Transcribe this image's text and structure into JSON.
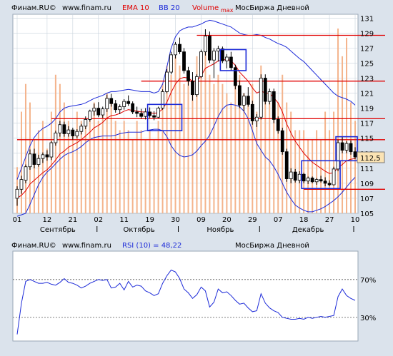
{
  "colors": {
    "background": "#dbe3ec",
    "plot_bg": "#ffffff",
    "grid": "#c8d2dc",
    "candle": "#000000",
    "ema": "#e00000",
    "bb": "#1c2ad8",
    "volume": "#f4b48c",
    "hline": "#e00000",
    "box": "#1c2ad8",
    "rsi": "#1c2ad8",
    "price_tag_bg": "#fbe3b3"
  },
  "main_header": {
    "brand": "Финам.RU©",
    "site": "www.finam.ru",
    "ema": "EMA 10",
    "bb": "BB 20",
    "volume": "Volume",
    "max": "max",
    "exchange": "МосБиржа Дневной"
  },
  "rsi_header": {
    "brand": "Финам.RU©",
    "site": "www.finam.ru",
    "rsi": "RSI (10) = 48,22",
    "exchange": "МосБиржа Дневной"
  },
  "last_price": "112,5",
  "chart_data": [
    {
      "type": "candlestick",
      "x_tick_labels": [
        "01",
        "12",
        "21",
        "02",
        "11",
        "19",
        "30",
        "09",
        "20",
        "29",
        "07",
        "18",
        "27",
        "10"
      ],
      "month_labels": [
        "Сентябрь",
        "Октябрь",
        "Ноябрь",
        "Декабрь"
      ],
      "y_ticks": [
        105,
        107,
        109,
        111,
        113,
        115,
        117,
        119,
        121,
        123,
        125,
        127,
        129,
        131
      ],
      "ylim": [
        105,
        131.5
      ],
      "grid": true,
      "candles": [
        [
          107.0,
          108.6,
          106.0,
          108.2
        ],
        [
          108.2,
          110.0,
          107.6,
          109.5
        ],
        [
          109.4,
          111.5,
          109.0,
          111.2
        ],
        [
          111.2,
          113.5,
          110.8,
          112.9
        ],
        [
          112.9,
          113.6,
          111.0,
          111.5
        ],
        [
          111.5,
          112.8,
          111.2,
          112.3
        ],
        [
          112.3,
          113.1,
          111.7,
          112.8
        ],
        [
          112.8,
          113.4,
          112.0,
          112.5
        ],
        [
          112.5,
          114.6,
          112.1,
          114.4
        ],
        [
          114.4,
          116.0,
          114.0,
          115.7
        ],
        [
          115.7,
          117.3,
          115.2,
          116.8
        ],
        [
          116.8,
          117.2,
          115.2,
          115.6
        ],
        [
          115.6,
          116.6,
          115.2,
          116.1
        ],
        [
          116.1,
          116.4,
          114.8,
          115.3
        ],
        [
          115.3,
          116.2,
          115.0,
          115.9
        ],
        [
          115.9,
          116.9,
          115.5,
          116.6
        ],
        [
          116.6,
          117.9,
          116.2,
          117.5
        ],
        [
          117.5,
          118.8,
          117.2,
          118.6
        ],
        [
          118.6,
          119.6,
          118.0,
          119.0
        ],
        [
          119.0,
          119.8,
          117.8,
          118.1
        ],
        [
          118.1,
          119.2,
          117.7,
          118.9
        ],
        [
          118.9,
          120.8,
          118.5,
          120.3
        ],
        [
          120.3,
          120.9,
          119.2,
          119.6
        ],
        [
          119.6,
          120.1,
          118.4,
          118.8
        ],
        [
          118.8,
          119.5,
          118.2,
          119.2
        ],
        [
          119.2,
          120.2,
          118.8,
          119.9
        ],
        [
          119.9,
          120.7,
          119.3,
          119.6
        ],
        [
          119.6,
          119.9,
          118.2,
          118.5
        ],
        [
          118.5,
          119.2,
          117.8,
          118.3
        ],
        [
          118.3,
          118.9,
          117.6,
          117.9
        ],
        [
          117.9,
          119.0,
          117.5,
          118.5
        ],
        [
          118.5,
          119.1,
          117.7,
          118.0
        ],
        [
          118.0,
          118.6,
          117.4,
          117.8
        ],
        [
          117.8,
          119.2,
          117.7,
          119.0
        ],
        [
          119.0,
          121.5,
          118.8,
          121.2
        ],
        [
          121.2,
          124.2,
          121.0,
          123.8
        ],
        [
          123.8,
          126.5,
          123.5,
          126.1
        ],
        [
          126.1,
          127.8,
          125.6,
          127.5
        ],
        [
          127.5,
          128.4,
          126.2,
          126.5
        ],
        [
          126.5,
          127.0,
          123.6,
          124.0
        ],
        [
          124.0,
          124.5,
          122.0,
          122.6
        ],
        [
          122.6,
          123.8,
          120.0,
          120.8
        ],
        [
          120.8,
          123.5,
          120.5,
          123.2
        ],
        [
          123.2,
          126.8,
          123.0,
          126.5
        ],
        [
          126.5,
          129.5,
          126.0,
          128.6
        ],
        [
          128.6,
          129.2,
          125.0,
          125.4
        ],
        [
          125.4,
          127.0,
          123.0,
          126.6
        ],
        [
          126.6,
          127.3,
          125.2,
          126.9
        ],
        [
          126.9,
          127.2,
          125.0,
          125.3
        ],
        [
          125.3,
          126.2,
          124.3,
          125.8
        ],
        [
          125.8,
          126.5,
          124.0,
          124.4
        ],
        [
          124.4,
          124.8,
          121.5,
          122.0
        ],
        [
          122.0,
          122.7,
          119.0,
          119.4
        ],
        [
          119.4,
          121.0,
          118.6,
          120.6
        ],
        [
          120.6,
          121.8,
          119.2,
          119.5
        ],
        [
          119.5,
          120.0,
          116.8,
          117.3
        ],
        [
          117.3,
          118.2,
          116.5,
          117.8
        ],
        [
          117.8,
          123.5,
          117.5,
          123.0
        ],
        [
          123.0,
          123.5,
          119.5,
          119.9
        ],
        [
          119.9,
          121.6,
          119.5,
          121.2
        ],
        [
          121.2,
          121.6,
          117.0,
          117.5
        ],
        [
          117.5,
          117.9,
          115.6,
          116.0
        ],
        [
          116.0,
          116.4,
          112.8,
          113.2
        ],
        [
          113.2,
          113.6,
          109.2,
          109.6
        ],
        [
          109.6,
          111.0,
          109.0,
          110.5
        ],
        [
          110.5,
          110.9,
          109.1,
          109.4
        ],
        [
          109.4,
          110.6,
          109.0,
          110.2
        ],
        [
          110.2,
          110.4,
          109.0,
          109.3
        ],
        [
          109.3,
          109.9,
          108.9,
          109.7
        ],
        [
          109.7,
          109.9,
          109.0,
          109.2
        ],
        [
          109.2,
          109.7,
          108.8,
          109.5
        ],
        [
          109.5,
          110.0,
          109.1,
          109.3
        ],
        [
          109.3,
          109.8,
          108.6,
          109.0
        ],
        [
          109.0,
          109.4,
          108.6,
          108.8
        ],
        [
          108.8,
          111.2,
          108.7,
          110.9
        ],
        [
          110.9,
          114.8,
          110.6,
          114.4
        ],
        [
          114.4,
          115.2,
          113.0,
          113.4
        ],
        [
          113.4,
          114.6,
          113.0,
          114.3
        ],
        [
          114.3,
          114.7,
          112.8,
          113.2
        ],
        [
          113.2,
          113.8,
          112.2,
          112.5
        ]
      ],
      "ema_10": [
        107.0,
        107.4,
        108.0,
        108.9,
        109.4,
        109.9,
        110.4,
        110.8,
        111.4,
        112.1,
        112.9,
        113.3,
        113.8,
        114.1,
        114.4,
        114.8,
        115.3,
        115.8,
        116.4,
        116.7,
        117.1,
        117.7,
        118.0,
        118.1,
        118.3,
        118.6,
        118.8,
        118.7,
        118.6,
        118.5,
        118.5,
        118.4,
        118.3,
        118.4,
        118.9,
        119.8,
        121.1,
        122.2,
        122.9,
        123.1,
        123.0,
        122.6,
        122.6,
        123.3,
        124.3,
        124.6,
        124.9,
        125.3,
        125.4,
        125.5,
        125.3,
        124.7,
        123.8,
        123.2,
        122.6,
        121.7,
        121.0,
        121.3,
        121.0,
        121.0,
        120.4,
        119.7,
        118.5,
        116.9,
        115.7,
        114.6,
        113.8,
        113.0,
        112.4,
        111.8,
        111.4,
        111.0,
        110.6,
        110.3,
        110.4,
        111.1,
        111.5,
        112.0,
        112.2,
        112.3
      ],
      "bb_upper": [
        109.5,
        111.0,
        112.5,
        114.0,
        115.1,
        115.8,
        116.3,
        116.6,
        117.0,
        117.6,
        118.5,
        119.0,
        119.2,
        119.3,
        119.4,
        119.5,
        119.7,
        120.0,
        120.3,
        120.5,
        120.7,
        121.0,
        121.2,
        121.2,
        121.3,
        121.4,
        121.5,
        121.4,
        121.3,
        121.2,
        121.2,
        121.2,
        121.0,
        121.2,
        122.2,
        124.5,
        127.0,
        128.5,
        129.3,
        129.6,
        129.8,
        129.8,
        130.0,
        130.2,
        130.5,
        130.7,
        130.6,
        130.4,
        130.2,
        130.0,
        129.8,
        129.4,
        129.0,
        128.8,
        128.7,
        128.7,
        128.8,
        128.7,
        128.4,
        128.2,
        127.9,
        127.6,
        127.4,
        127.1,
        126.6,
        126.1,
        125.6,
        125.2,
        124.6,
        124.0,
        123.4,
        122.8,
        122.2,
        121.6,
        121.0,
        120.6,
        120.4,
        120.2,
        119.9,
        119.4
      ],
      "bb_lower": [
        104.6,
        104.8,
        105.0,
        106.2,
        107.5,
        108.8,
        109.8,
        110.5,
        111.0,
        111.6,
        112.2,
        112.7,
        113.0,
        113.2,
        113.5,
        113.9,
        114.4,
        114.8,
        115.1,
        115.2,
        115.3,
        115.3,
        115.3,
        115.4,
        115.6,
        115.7,
        115.8,
        115.8,
        115.8,
        115.8,
        116.0,
        116.1,
        116.2,
        116.2,
        116.0,
        115.2,
        114.0,
        113.2,
        112.7,
        112.5,
        112.6,
        112.8,
        113.3,
        114.0,
        114.6,
        115.4,
        116.6,
        117.9,
        118.9,
        119.4,
        119.5,
        119.4,
        119.2,
        118.6,
        117.6,
        116.0,
        114.3,
        113.4,
        112.5,
        112.0,
        111.2,
        110.2,
        109.0,
        107.8,
        106.9,
        106.1,
        105.7,
        105.4,
        105.2,
        105.2,
        105.4,
        105.6,
        105.9,
        106.3,
        106.7,
        107.2,
        107.8,
        108.5,
        109.2,
        109.8
      ],
      "volumes": [
        0.25,
        0.55,
        0.7,
        0.6,
        0.4,
        0.45,
        0.5,
        0.35,
        0.55,
        0.75,
        0.7,
        0.6,
        0.5,
        0.45,
        0.55,
        0.5,
        0.5,
        0.55,
        0.6,
        0.5,
        0.55,
        0.65,
        0.6,
        0.5,
        0.45,
        0.5,
        0.45,
        0.4,
        0.5,
        0.45,
        0.4,
        0.45,
        0.4,
        0.5,
        0.7,
        0.8,
        0.75,
        0.85,
        0.8,
        0.7,
        0.75,
        0.65,
        0.85,
        0.85,
        0.9,
        0.75,
        0.7,
        0.75,
        0.7,
        0.65,
        0.6,
        0.7,
        0.75,
        0.65,
        0.6,
        0.7,
        0.55,
        0.8,
        0.7,
        0.6,
        0.65,
        0.6,
        0.75,
        0.6,
        0.55,
        0.45,
        0.45,
        0.45,
        0.4,
        0.4,
        0.45,
        0.4,
        0.55,
        0.45,
        0.55,
        1.0,
        0.85,
        0.95,
        0.6,
        0.5
      ],
      "horizontal_levels": [
        [
          128.7,
          "from_x",
          42
        ],
        [
          122.6,
          "from_x",
          29
        ],
        [
          117.6,
          "from_x",
          8
        ],
        [
          114.8,
          "from_x",
          0
        ],
        [
          108.2,
          "from_x",
          67
        ]
      ],
      "boxes": [
        [
          31,
          38,
          116.0,
          119.5
        ],
        [
          48,
          53,
          124.0,
          126.8
        ],
        [
          67,
          75,
          108.3,
          112.0
        ],
        [
          75,
          79,
          112.0,
          115.2
        ]
      ]
    },
    {
      "type": "line",
      "series_label": "RSI (10)",
      "y_ticks": [
        30,
        70
      ],
      "y_tick_labels": [
        "30%",
        "70%"
      ],
      "ylim": [
        5,
        100
      ],
      "grid": false,
      "values": [
        12,
        45,
        68,
        70,
        68,
        66,
        66,
        67,
        65,
        64,
        67,
        71,
        67,
        66,
        64,
        61,
        63,
        66,
        68,
        70,
        69,
        70,
        61,
        62,
        66,
        59,
        68,
        62,
        64,
        63,
        58,
        56,
        53,
        55,
        66,
        74,
        80,
        78,
        71,
        60,
        56,
        50,
        54,
        62,
        58,
        41,
        46,
        60,
        56,
        57,
        53,
        48,
        44,
        45,
        40,
        36,
        37,
        55,
        45,
        40,
        37,
        35,
        30,
        29,
        28,
        28,
        29,
        28,
        30,
        29,
        30,
        31,
        30,
        31,
        32,
        52,
        60,
        53,
        50,
        48
      ]
    }
  ]
}
